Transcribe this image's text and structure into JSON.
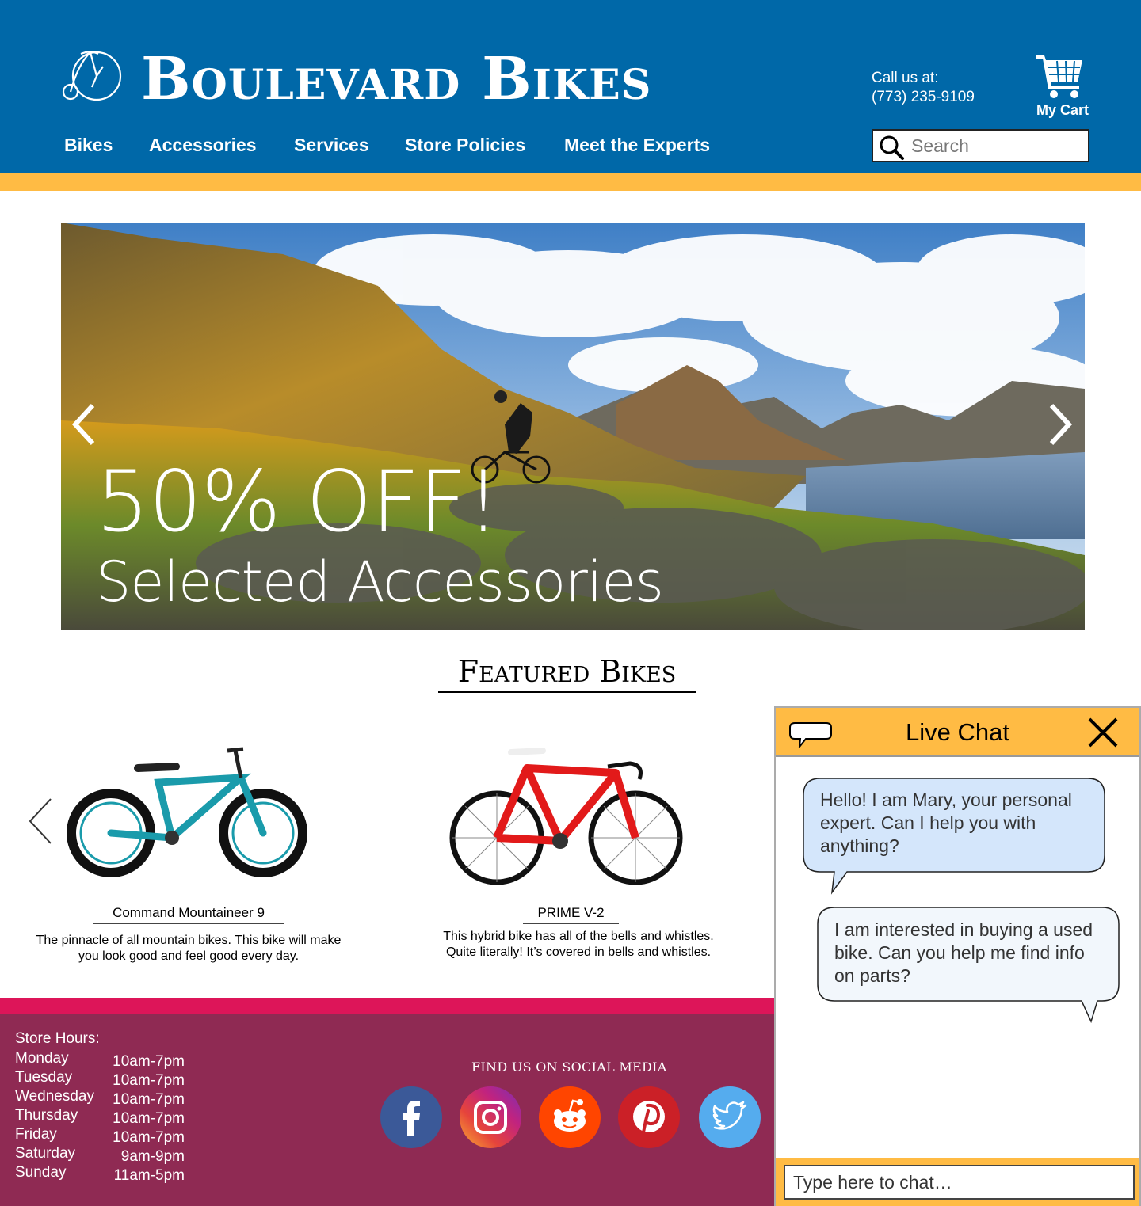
{
  "header": {
    "brand": "Boulevard Bikes",
    "call_label": "Call us at:",
    "phone": "(773) 235-9109",
    "cart_label": "My Cart",
    "nav": [
      "Bikes",
      "Accessories",
      "Services",
      "Store Policies",
      "Meet the Experts"
    ],
    "search_placeholder": "Search"
  },
  "hero": {
    "title": "50% OFF!",
    "subtitle": "Selected Accessories"
  },
  "featured": {
    "title": "Featured Bikes",
    "bikes": [
      {
        "name": "Command Mountaineer 9",
        "description": "The pinnacle of all mountain bikes. This bike will make you look good and feel good every day.",
        "color": "#1a9bab"
      },
      {
        "name": "PRIME V-2",
        "description": "This hybrid bike has all of the bells and whistles. Quite literally! It’s covered in bells and whistles.",
        "color": "#e21a1a"
      }
    ]
  },
  "footer": {
    "hours_title": "Store Hours:",
    "hours": [
      {
        "day": "Monday",
        "time": "10am-7pm"
      },
      {
        "day": "Tuesday",
        "time": "10am-7pm"
      },
      {
        "day": "Wednesday",
        "time": "10am-7pm"
      },
      {
        "day": "Thursday",
        "time": "10am-7pm"
      },
      {
        "day": "Friday",
        "time": "10am-7pm"
      },
      {
        "day": "Saturday",
        "time": "9am-9pm"
      },
      {
        "day": "Sunday",
        "time": "11am-5pm"
      }
    ],
    "social_title": "FIND US ON SOCIAL MEDIA",
    "social": [
      {
        "icon": "facebook-icon",
        "color": "#3b5998"
      },
      {
        "icon": "instagram-icon",
        "color": "#d6249f"
      },
      {
        "icon": "reddit-icon",
        "color": "#ff4500"
      },
      {
        "icon": "pinterest-icon",
        "color": "#cb2027"
      },
      {
        "icon": "twitter-icon",
        "color": "#55acee"
      }
    ]
  },
  "chat": {
    "title": "Live Chat",
    "messages": [
      {
        "from": "expert",
        "text": "Hello! I am Mary, your personal expert. Can I help you with anything?"
      },
      {
        "from": "user",
        "text": "I am interested in buying a used bike. Can you help me find info on parts?"
      }
    ],
    "input_placeholder": "Type here to chat…"
  },
  "colors": {
    "header_blue": "#0068a8",
    "accent_gold": "#ffbb44",
    "footer_pink": "#dd1559",
    "footer_plum": "#8f2a53",
    "chat_bubble_blue": "#d4e6fb"
  }
}
